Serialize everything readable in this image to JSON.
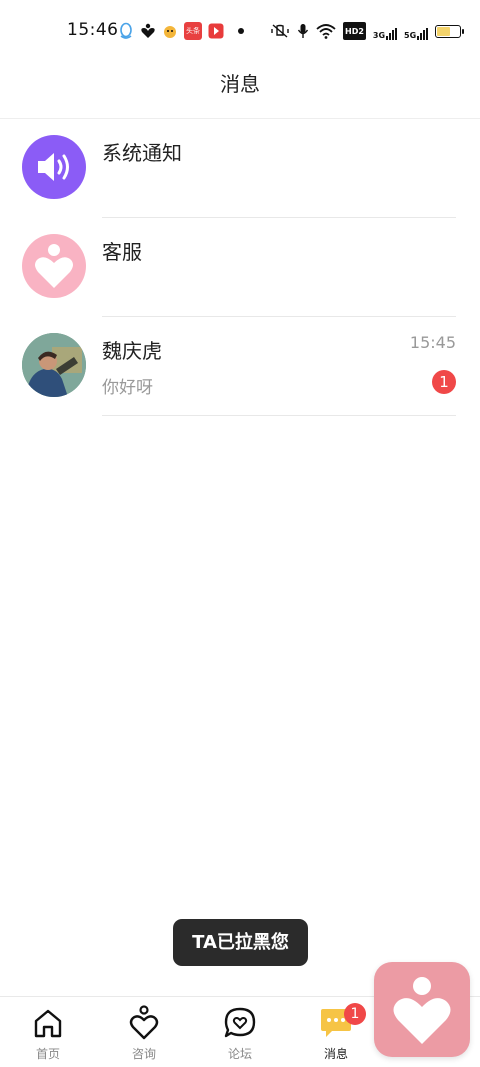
{
  "status_bar": {
    "time": "15:46",
    "app_badge_text": "头条",
    "network_badge": "HD2",
    "sim1": "3G",
    "sim2": "5G"
  },
  "header": {
    "title": "消息"
  },
  "conversations": [
    {
      "name": "系统通知",
      "avatar_icon": "speaker-icon",
      "avatar_color": "#8b5cf6"
    },
    {
      "name": "客服",
      "avatar_icon": "heart-person-icon",
      "avatar_color": "#f9b3c3"
    },
    {
      "name": "魏庆虎",
      "avatar_icon": "photo-avatar",
      "time": "15:45",
      "preview": "你好呀",
      "unread": "1"
    }
  ],
  "toast": {
    "text": "TA已拉黑您"
  },
  "tabbar": {
    "tabs": [
      {
        "label": "首页",
        "icon": "home-icon"
      },
      {
        "label": "咨询",
        "icon": "heart-person-icon"
      },
      {
        "label": "论坛",
        "icon": "heart-chat-icon"
      },
      {
        "label": "消息",
        "icon": "message-icon",
        "badge": "1",
        "active": true
      }
    ]
  },
  "colors": {
    "accent_purple": "#8b5cf6",
    "pink": "#f9b3c3",
    "badge_red": "#f04848",
    "message_yellow": "#f6c445",
    "float_pink": "#ec9ba4"
  }
}
